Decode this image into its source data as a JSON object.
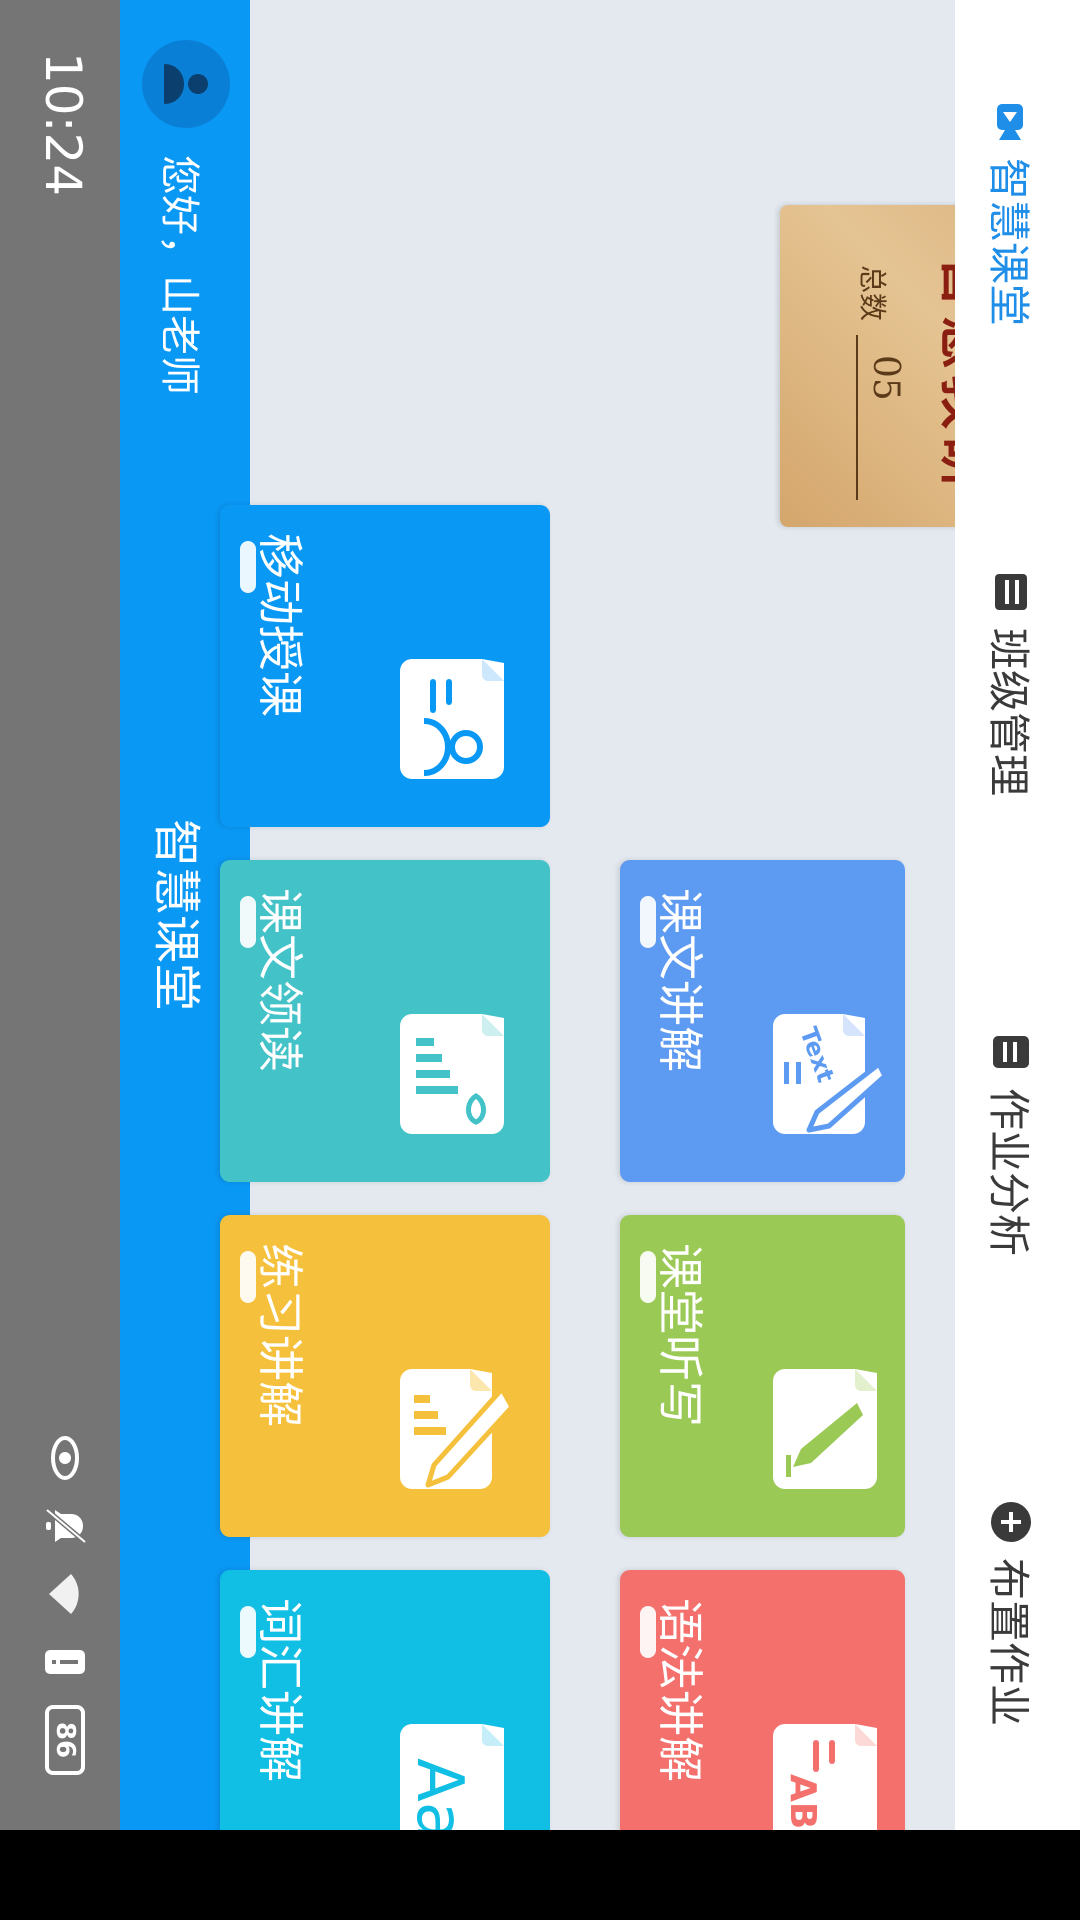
{
  "status_bar": {
    "time": "10:24",
    "battery": "86"
  },
  "header": {
    "greeting": "您好，山老师",
    "title": "智慧课堂"
  },
  "tiles": [
    {
      "label": "移动授课",
      "color": "#0a98f5",
      "icon": "document-person-icon"
    },
    {
      "label": "课文领读",
      "color": "#43c2c8",
      "icon": "document-bars-speech-icon"
    },
    {
      "label": "练习讲解",
      "color": "#f5c03b",
      "icon": "document-pencil-bars-icon"
    },
    {
      "label": "词汇讲解",
      "color": "#10bfe3",
      "icon": "document-aa-icon"
    },
    {
      "label": "课文讲解",
      "color": "#5d9af2",
      "icon": "document-text-pencil-icon"
    },
    {
      "label": "课堂听写",
      "color": "#9ac955",
      "icon": "document-pen-icon"
    },
    {
      "label": "语法讲解",
      "color": "#f3706c",
      "icon": "document-abc-icon"
    }
  ],
  "research_card": {
    "title": "智慧教研",
    "count_label": "总数",
    "count": "05"
  },
  "bottom_nav": {
    "items": [
      {
        "label": "智慧课堂",
        "icon": "classroom-video-icon",
        "active": true
      },
      {
        "label": "班级管理",
        "icon": "class-manage-icon",
        "active": false
      },
      {
        "label": "作业分析",
        "icon": "homework-analysis-icon",
        "active": false
      },
      {
        "label": "布置作业",
        "icon": "plus-circle-icon",
        "active": false
      }
    ]
  }
}
